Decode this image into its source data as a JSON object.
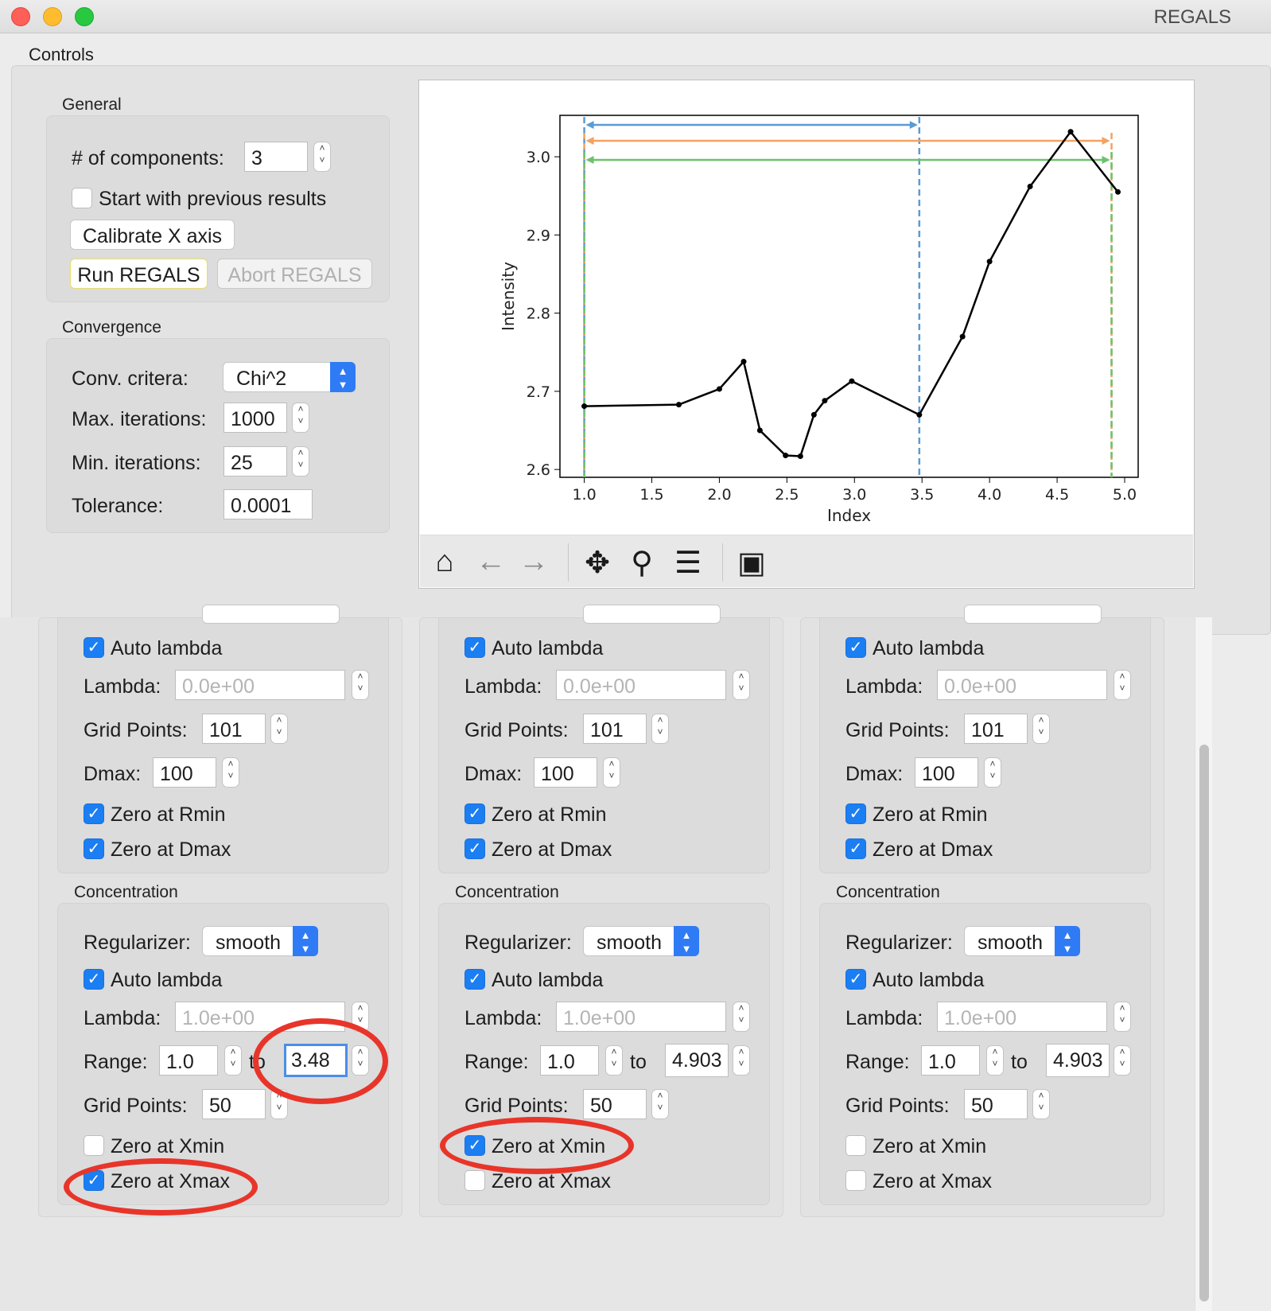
{
  "window": {
    "title": "REGALS"
  },
  "menu": {
    "controls": "Controls"
  },
  "general": {
    "title": "General",
    "components_label": "# of components:",
    "components_value": "3",
    "start_prev_label": "Start with previous results",
    "calibrate_label": "Calibrate X axis",
    "run_label": "Run REGALS",
    "abort_label": "Abort REGALS"
  },
  "convergence": {
    "title": "Convergence",
    "criteria_label": "Conv. critera:",
    "criteria_value": "Chi^2",
    "max_iter_label": "Max. iterations:",
    "max_iter_value": "1000",
    "min_iter_label": "Min. iterations:",
    "min_iter_value": "25",
    "tolerance_label": "Tolerance:",
    "tolerance_value": "0.0001"
  },
  "plot_toolbar": [
    "home-icon",
    "back-arrow-icon",
    "forward-arrow-icon",
    "pan-icon",
    "zoom-icon",
    "configure-icon",
    "save-icon"
  ],
  "chart_data": {
    "type": "line",
    "xlabel": "Index",
    "ylabel": "Intensity",
    "xlim": [
      0.82,
      5.1
    ],
    "ylim": [
      2.59,
      3.053
    ],
    "xticks": [
      "1.0",
      "1.5",
      "2.0",
      "2.5",
      "3.0",
      "3.5",
      "4.0",
      "4.5",
      "5.0"
    ],
    "yticks": [
      "2.6",
      "2.7",
      "2.8",
      "2.9",
      "3.0"
    ],
    "series": [
      {
        "x": [
          1.0,
          1.7,
          2.0,
          2.18,
          2.3,
          2.49,
          2.6,
          2.7,
          2.78,
          2.98,
          3.48,
          3.8,
          4.0,
          4.3,
          4.6,
          4.95
        ],
        "y": [
          2.681,
          2.683,
          2.703,
          2.738,
          2.65,
          2.618,
          2.617,
          2.67,
          2.688,
          2.713,
          2.67,
          2.77,
          2.866,
          2.962,
          3.032,
          2.955
        ],
        "color": "#000000"
      }
    ],
    "ranges": [
      {
        "xmin": 1.0,
        "xmax": 3.48,
        "color": "#5b9bd5"
      },
      {
        "xmin": 1.0,
        "xmax": 4.903,
        "color": "#f4a261"
      },
      {
        "xmin": 1.0,
        "xmax": 4.903,
        "color": "#6cc26c"
      }
    ],
    "grid": false
  },
  "components": [
    {
      "profile": {
        "auto_lambda_label": "Auto lambda",
        "auto_lambda": true,
        "lambda_label": "Lambda:",
        "lambda_value": "0.0e+00",
        "grid_points_label": "Grid Points:",
        "grid_points_value": "101",
        "dmax_label": "Dmax:",
        "dmax_value": "100",
        "zero_rmin_label": "Zero at Rmin",
        "zero_rmin": true,
        "zero_dmax_label": "Zero at Dmax",
        "zero_dmax": true
      },
      "concentration": {
        "title": "Concentration",
        "regularizer_label": "Regularizer:",
        "regularizer_value": "smooth",
        "auto_lambda_label": "Auto lambda",
        "auto_lambda": true,
        "lambda_label": "Lambda:",
        "lambda_value": "1.0e+00",
        "range_label": "Range:",
        "range_min": "1.0",
        "range_to": "to",
        "range_max": "3.48",
        "grid_points_label": "Grid Points:",
        "grid_points_value": "50",
        "zero_xmin_label": "Zero at Xmin",
        "zero_xmin": false,
        "zero_xmax_label": "Zero at Xmax",
        "zero_xmax": true
      }
    },
    {
      "profile": {
        "auto_lambda_label": "Auto lambda",
        "auto_lambda": true,
        "lambda_label": "Lambda:",
        "lambda_value": "0.0e+00",
        "grid_points_label": "Grid Points:",
        "grid_points_value": "101",
        "dmax_label": "Dmax:",
        "dmax_value": "100",
        "zero_rmin_label": "Zero at Rmin",
        "zero_rmin": true,
        "zero_dmax_label": "Zero at Dmax",
        "zero_dmax": true
      },
      "concentration": {
        "title": "Concentration",
        "regularizer_label": "Regularizer:",
        "regularizer_value": "smooth",
        "auto_lambda_label": "Auto lambda",
        "auto_lambda": true,
        "lambda_label": "Lambda:",
        "lambda_value": "1.0e+00",
        "range_label": "Range:",
        "range_min": "1.0",
        "range_to": "to",
        "range_max": "4.903",
        "grid_points_label": "Grid Points:",
        "grid_points_value": "50",
        "zero_xmin_label": "Zero at Xmin",
        "zero_xmin": true,
        "zero_xmax_label": "Zero at Xmax",
        "zero_xmax": false
      }
    },
    {
      "profile": {
        "auto_lambda_label": "Auto lambda",
        "auto_lambda": true,
        "lambda_label": "Lambda:",
        "lambda_value": "0.0e+00",
        "grid_points_label": "Grid Points:",
        "grid_points_value": "101",
        "dmax_label": "Dmax:",
        "dmax_value": "100",
        "zero_rmin_label": "Zero at Rmin",
        "zero_rmin": true,
        "zero_dmax_label": "Zero at Dmax",
        "zero_dmax": true
      },
      "concentration": {
        "title": "Concentration",
        "regularizer_label": "Regularizer:",
        "regularizer_value": "smooth",
        "auto_lambda_label": "Auto lambda",
        "auto_lambda": true,
        "lambda_label": "Lambda:",
        "lambda_value": "1.0e+00",
        "range_label": "Range:",
        "range_min": "1.0",
        "range_to": "to",
        "range_max": "4.903",
        "grid_points_label": "Grid Points:",
        "grid_points_value": "50",
        "zero_xmin_label": "Zero at Xmin",
        "zero_xmin": false,
        "zero_xmax_label": "Zero at Xmax",
        "zero_xmax": false
      }
    }
  ],
  "annotation_color": "#e8352a"
}
